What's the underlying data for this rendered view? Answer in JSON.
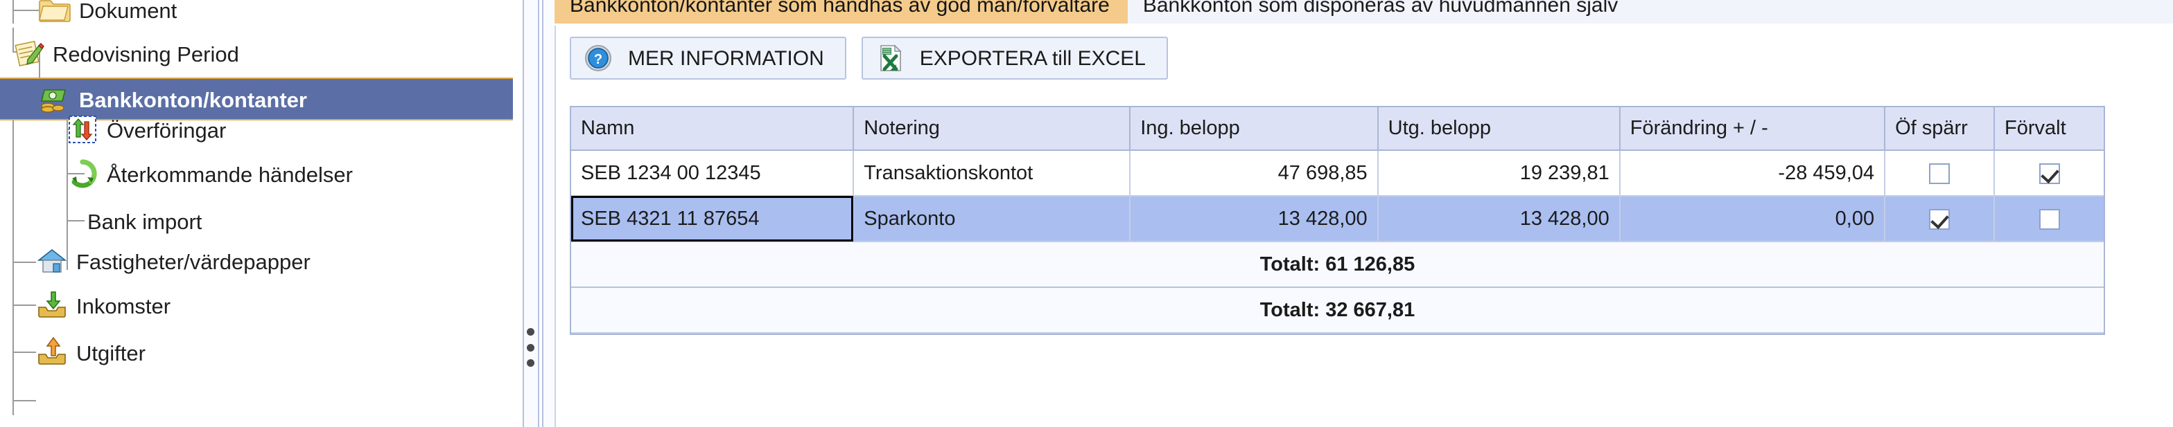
{
  "sidebar": {
    "items": [
      {
        "id": "dokument",
        "label": "Dokument",
        "icon": "folder-icon",
        "indent": 1,
        "selected": false
      },
      {
        "id": "redovisning",
        "label": "Redovisning Period",
        "icon": "notepad-pencil-icon",
        "indent": 0,
        "selected": false
      },
      {
        "id": "bankkonton",
        "label": "Bankkonton/kontanter",
        "icon": "money-icon",
        "indent": 1,
        "selected": true
      },
      {
        "id": "overforingar",
        "label": "Överföringar",
        "icon": "transfer-arrows-icon",
        "indent": 2,
        "selected": false
      },
      {
        "id": "aterkommande",
        "label": "Återkommande händelser",
        "icon": "recycle-icon",
        "indent": 2,
        "selected": false
      },
      {
        "id": "bankimport",
        "label": "Bank import",
        "icon": "none",
        "indent": 2,
        "selected": false
      },
      {
        "id": "fastigheter",
        "label": "Fastigheter/värdepapper",
        "icon": "house-icon",
        "indent": 1,
        "selected": false
      },
      {
        "id": "inkomster",
        "label": "Inkomster",
        "icon": "inbox-down-icon",
        "indent": 1,
        "selected": false
      },
      {
        "id": "utgifter",
        "label": "Utgifter",
        "icon": "outbox-up-icon",
        "indent": 1,
        "selected": false
      }
    ]
  },
  "tabs": [
    {
      "id": "tab-god-man",
      "label": "Bankkonton/kontanter som handhas av god man/förvaltare",
      "active": true
    },
    {
      "id": "tab-huvudman",
      "label": "Bankkonton som disponeras av huvudmannen själv",
      "active": false
    }
  ],
  "toolbar": {
    "more_info_label": "MER INFORMATION",
    "more_info_icon": "help-question-icon",
    "export_excel_label": "EXPORTERA till EXCEL",
    "export_excel_icon": "excel-icon"
  },
  "table": {
    "columns": [
      "Namn",
      "Notering",
      "Ing. belopp",
      "Utg. belopp",
      "Förändring + / -",
      "Öf spärr",
      "Förvalt"
    ],
    "rows": [
      {
        "namn": "SEB 1234 00 12345",
        "notering": "Transaktionskontot",
        "ing_belopp": "47 698,85",
        "utg_belopp": "19 239,81",
        "forandring": "-28 459,04",
        "of_sparr": false,
        "forvalt": true,
        "selected": false,
        "focused_cell": false
      },
      {
        "namn": "SEB 4321 11 87654",
        "notering": "Sparkonto",
        "ing_belopp": "13 428,00",
        "utg_belopp": "13 428,00",
        "forandring": "0,00",
        "of_sparr": true,
        "forvalt": false,
        "selected": true,
        "focused_cell": true
      }
    ],
    "totals": [
      {
        "id": "total-ing",
        "label": "Totalt: 61 126,85"
      },
      {
        "id": "total-utg",
        "label": "Totalt: 32 667,81"
      }
    ]
  },
  "colors": {
    "tab_active_bg": "#f4cb8a",
    "tab_inactive_bg": "#f1f4fb",
    "tree_selection_bg": "#5b6fa6",
    "tree_selection_border": "#e3a93c",
    "grid_header_bg": "#dde1f5",
    "row_selected_bg": "#aabef0",
    "grid_border": "#a8b6d6"
  },
  "splitter": {
    "grip_icon": "splitter-grip-icon"
  }
}
